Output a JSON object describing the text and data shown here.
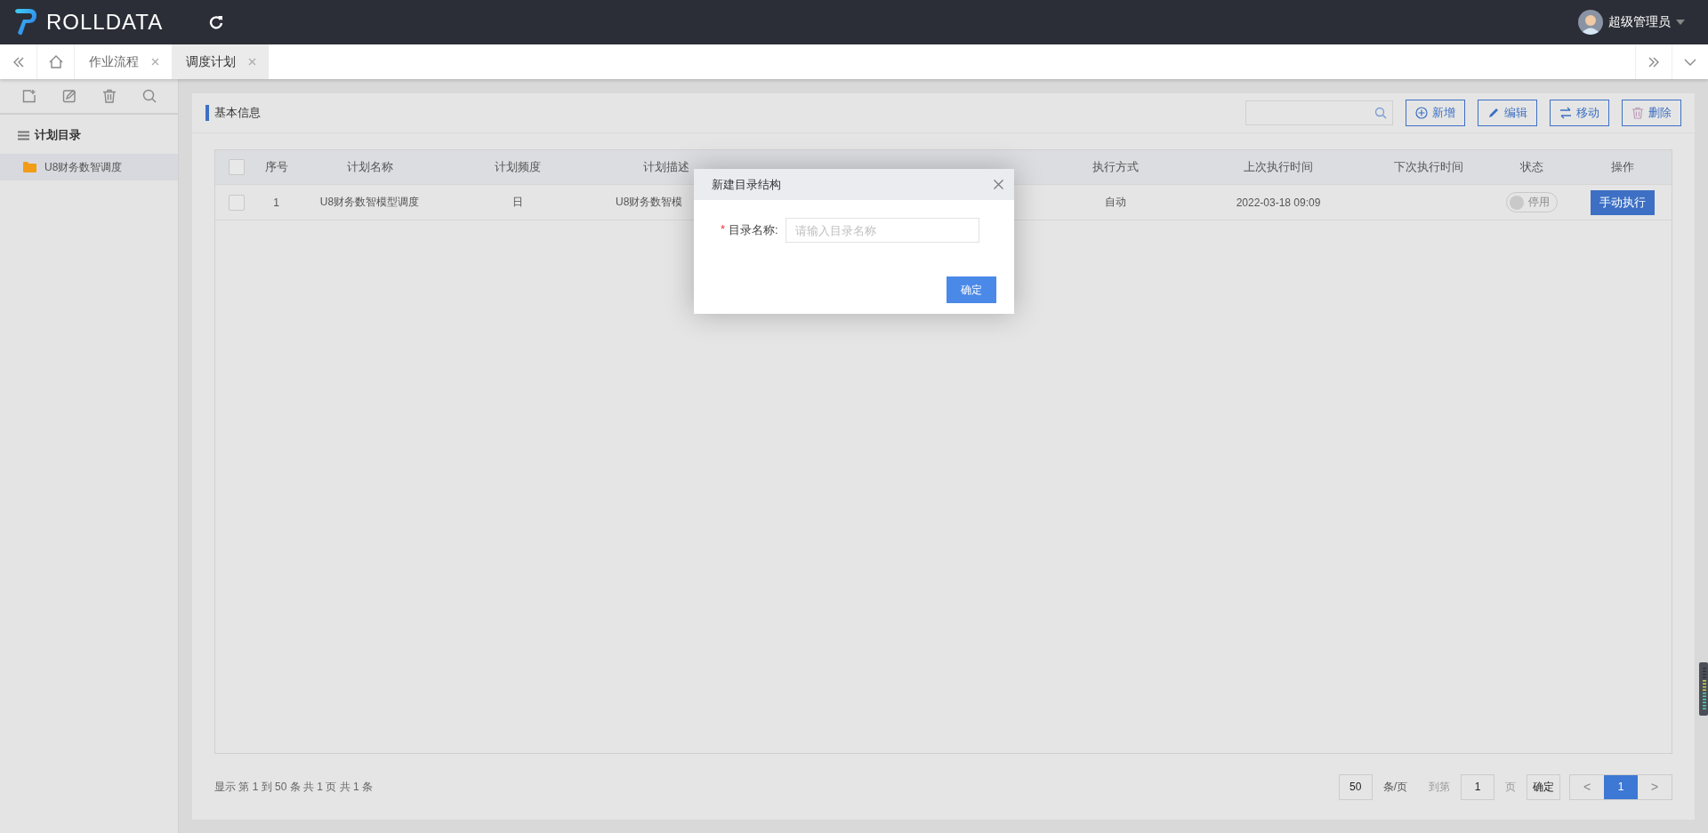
{
  "topbar": {
    "logo": "ROLLDATA",
    "user": "超级管理员"
  },
  "tabs": [
    {
      "label": "作业流程",
      "selected": false
    },
    {
      "label": "调度计划",
      "selected": true
    }
  ],
  "sidebar": {
    "title": "计划目录",
    "items": [
      {
        "label": "U8财务数智调度",
        "selected": true
      }
    ]
  },
  "panel": {
    "title": "基本信息",
    "buttons": [
      {
        "kind": "add",
        "label": "新增"
      },
      {
        "kind": "edit",
        "label": "编辑"
      },
      {
        "kind": "move",
        "label": "移动"
      },
      {
        "kind": "delete",
        "label": "删除"
      }
    ]
  },
  "table": {
    "all_checked": false,
    "columns": [
      "序号",
      "计划名称",
      "计划频度",
      "计划描述",
      null,
      null,
      "执行方式",
      "上次执行时间",
      "下次执行时间",
      "状态",
      "操作"
    ],
    "rows": [
      {
        "checked": false,
        "cells": [
          "1",
          "U8财务数智模型调度",
          "日",
          "U8财务数智模",
          null,
          null,
          "自动",
          "2022-03-18 09:09",
          null
        ],
        "status": {
          "label": "停用",
          "on": false
        },
        "action": "手动执行"
      }
    ]
  },
  "pagination": {
    "summary": "显示 第 1 到 50 条 共 1 页 共 1 条",
    "page_size": "50",
    "per_page": "条/页",
    "goto": "到第",
    "goto_value": "1",
    "page_unit": "页",
    "confirm": "确定",
    "prev": "<",
    "next": ">",
    "pages": [
      {
        "label": "1",
        "selected": true
      }
    ]
  },
  "modal": {
    "title": "新建目录结构",
    "field": {
      "label": "目录名称:",
      "required_mark": "*",
      "placeholder": "请输入目录名称"
    },
    "confirm": "确定"
  }
}
